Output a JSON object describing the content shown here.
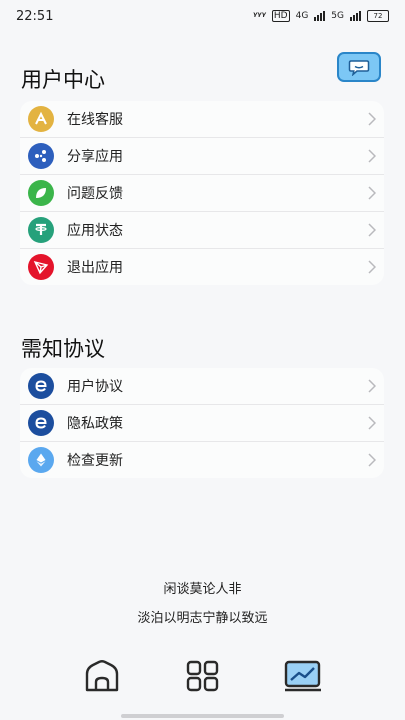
{
  "status_bar": {
    "time": "22:51",
    "hd_badge": "HD",
    "net1": "4G",
    "net2": "5G",
    "battery": "72"
  },
  "user_center": {
    "title": "用户中心",
    "items": [
      {
        "label": "在线客服",
        "icon": "support-icon",
        "color": "#e3b341"
      },
      {
        "label": "分享应用",
        "icon": "share-icon",
        "color": "#2d5fbd"
      },
      {
        "label": "问题反馈",
        "icon": "leaf-icon",
        "color": "#3bb54a"
      },
      {
        "label": "应用状态",
        "icon": "status-icon",
        "color": "#26a17b"
      },
      {
        "label": "退出应用",
        "icon": "exit-icon",
        "color": "#e4142b"
      }
    ]
  },
  "agreements": {
    "title": "需知协议",
    "items": [
      {
        "label": "用户协议",
        "icon": "e-icon",
        "color": "#1c4e9e"
      },
      {
        "label": "隐私政策",
        "icon": "e-icon",
        "color": "#1c4e9e"
      },
      {
        "label": "检查更新",
        "icon": "diamond-icon",
        "color": "#5aa8ef"
      }
    ]
  },
  "quotes": [
    "闲谈莫论人非",
    "淡泊以明志宁静以致远"
  ],
  "bottom_nav": [
    "home-icon",
    "apps-icon",
    "stats-icon"
  ]
}
